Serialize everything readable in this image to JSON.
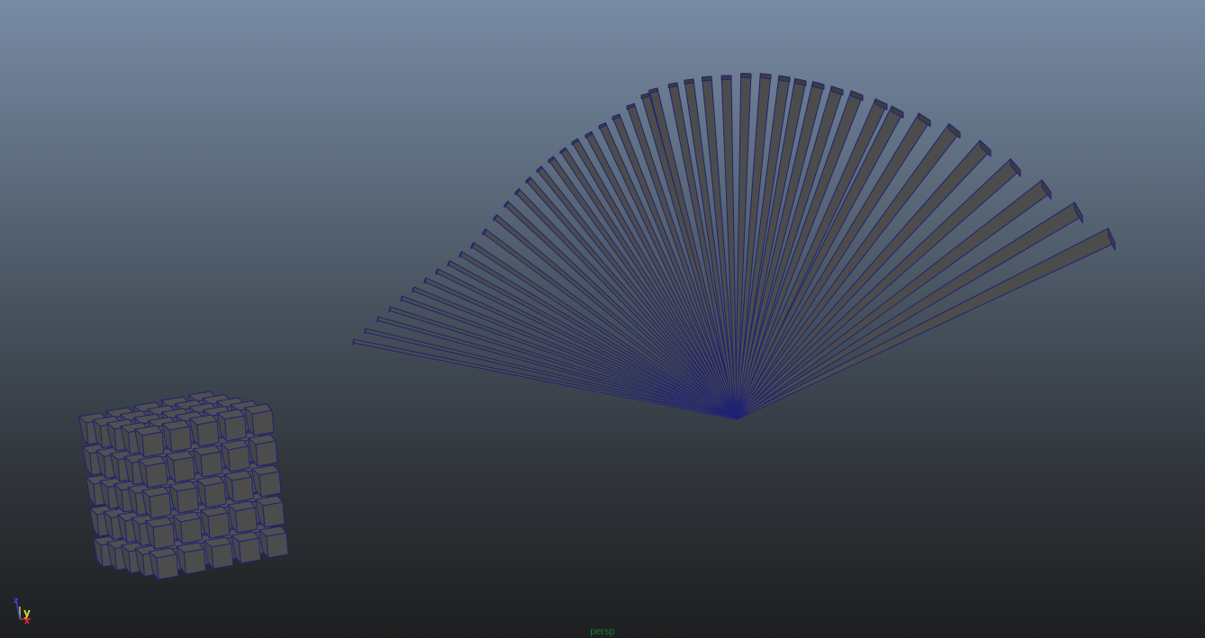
{
  "viewport": {
    "camera_name": "persp",
    "background_top": "#788ba4",
    "background_bottom": "#1d1f21",
    "wireframe_color": "#1f2373",
    "face_color": "#4c4c4c"
  },
  "axis_gizmo": {
    "labels": {
      "x": "x",
      "y": "y",
      "z": "z"
    },
    "colors": {
      "x": "#e03030",
      "y": "#d6d63a",
      "z": "#3a45d8"
    }
  },
  "scene": {
    "objects": [
      {
        "name": "twisted-plank-array",
        "count": 46
      },
      {
        "name": "cube-grid-array",
        "columns": 5,
        "rows": 5,
        "layers": 5
      }
    ]
  }
}
